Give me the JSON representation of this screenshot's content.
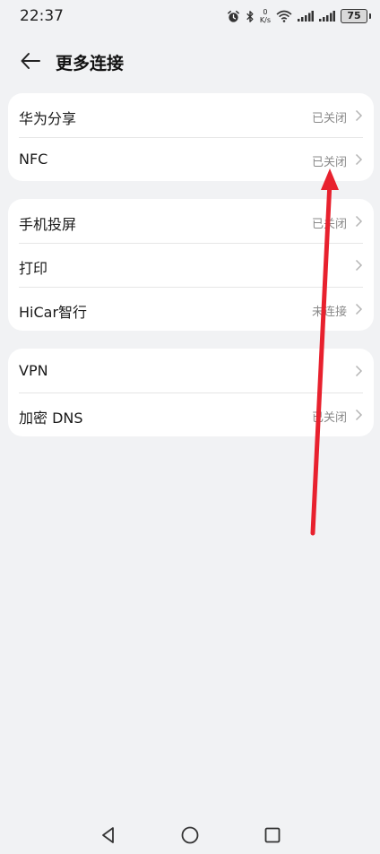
{
  "status_bar": {
    "time": "22:37",
    "net_speed_value": "0",
    "net_speed_unit": "K/s",
    "battery": "75"
  },
  "header": {
    "title": "更多连接",
    "back_icon": "back-arrow-icon"
  },
  "groups": [
    {
      "items": [
        {
          "label": "华为分享",
          "status": "已关闭"
        },
        {
          "label": "NFC",
          "status": "已关闭"
        }
      ]
    },
    {
      "items": [
        {
          "label": "手机投屏",
          "status": "已关闭"
        },
        {
          "label": "打印",
          "status": ""
        },
        {
          "label": "HiCar智行",
          "status": "未连接"
        }
      ]
    },
    {
      "items": [
        {
          "label": "VPN",
          "status": ""
        },
        {
          "label": "加密 DNS",
          "status": "已关闭"
        }
      ]
    }
  ],
  "annotation": {
    "color": "#e8212e",
    "icon": "red-swipe-arrow"
  },
  "nav_bar": {
    "icons": [
      "back-triangle-icon",
      "home-circle-icon",
      "recents-square-icon"
    ]
  }
}
